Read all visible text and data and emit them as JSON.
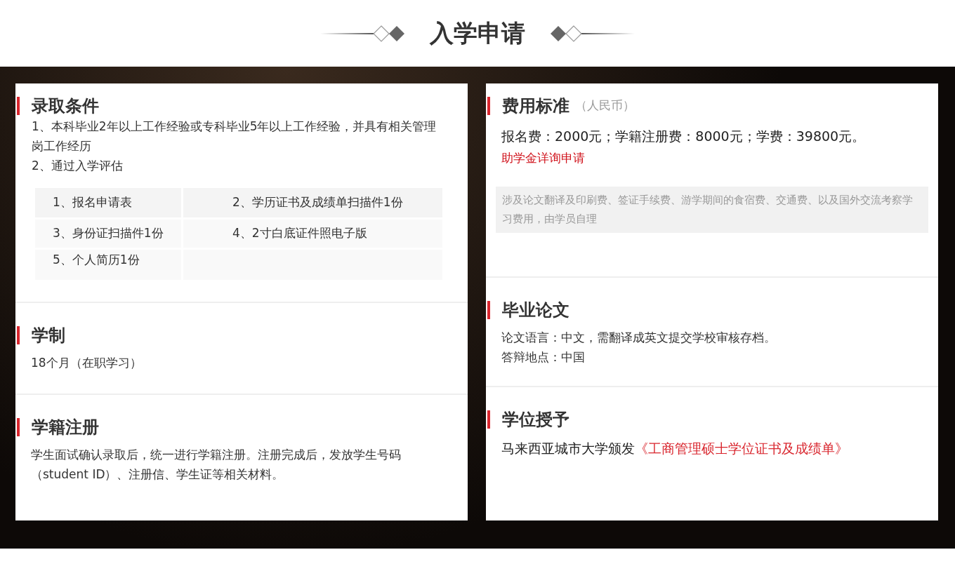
{
  "page_title": "入学申请",
  "left_sections": [
    {
      "kind": "admission",
      "title": "录取条件",
      "paragraphs": [
        "1、本科毕业2年以上工作经验或专科毕业5年以上工作经验，并具有相关管理岗工作经历",
        "2、通过入学评估"
      ],
      "materials": [
        "1、报名申请表",
        "2、学历证书及成绩单扫描件1份",
        "3、身份证扫描件1份",
        "4、2寸白底证件照电子版",
        "5、个人简历1份"
      ]
    },
    {
      "kind": "text",
      "title": "学制",
      "paragraphs": [
        "18个月（在职学习）"
      ]
    },
    {
      "kind": "text",
      "title": "学籍注册",
      "paragraphs": [
        "学生面试确认录取后，统一进行学籍注册。注册完成后，发放学生号码（student ID）、注册信、学生证等相关材料。"
      ]
    }
  ],
  "right_sections": [
    {
      "kind": "fees",
      "title": "费用标准",
      "subtitle": "（人民币）",
      "paragraphs": [
        "报名费：2000元；学籍注册费：8000元；学费：39800元。"
      ],
      "link": "助学金详询申请",
      "note": "涉及论文翻译及印刷费、签证手续费、游学期间的食宿费、交通费、以及国外交流考察学习费用，由学员自理"
    },
    {
      "kind": "text",
      "title": "毕业论文",
      "paragraphs": [
        "论文语言：中文，需翻译成英文提交学校审核存档。",
        "答辩地点：中国"
      ]
    },
    {
      "kind": "award",
      "title": "学位授予",
      "paragraphs": [
        "马来西亚城市大学颁发"
      ],
      "link": "《工商管理硕士学位证书及成绩单》"
    }
  ]
}
